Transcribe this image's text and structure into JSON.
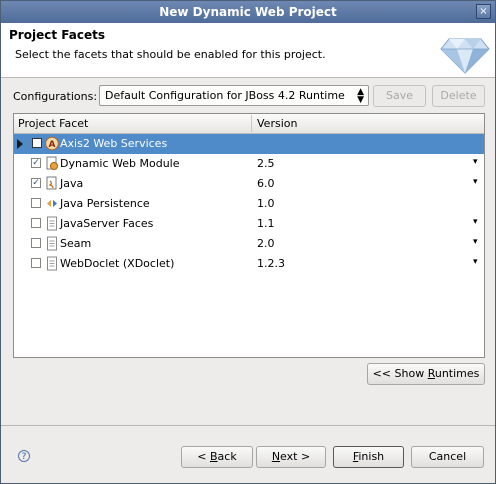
{
  "window": {
    "title": "New Dynamic Web Project",
    "close_glyph": "×"
  },
  "header": {
    "title": "Project Facets",
    "description": "Select the facets that should be enabled for this project.",
    "icon": "diamond-wizard-icon"
  },
  "config": {
    "label": "Configurations:",
    "selected": "Default Configuration for JBoss 4.2 Runtime",
    "save_label": "Save",
    "delete_label": "Delete"
  },
  "table": {
    "columns": [
      "Project Facet",
      "Version"
    ],
    "rows": [
      {
        "name": "Axis2 Web Services",
        "version": "",
        "checked": false,
        "selected": true,
        "icon": "axis2-icon",
        "dropdown": false,
        "expander": true
      },
      {
        "name": "Dynamic Web Module",
        "version": "2.5",
        "checked": true,
        "icon": "web-module-icon",
        "dropdown": true
      },
      {
        "name": "Java",
        "version": "6.0",
        "checked": true,
        "icon": "java-icon",
        "dropdown": true
      },
      {
        "name": "Java Persistence",
        "version": "1.0",
        "checked": false,
        "icon": "persistence-icon",
        "dropdown": false
      },
      {
        "name": "JavaServer Faces",
        "version": "1.1",
        "checked": false,
        "icon": "page-icon",
        "dropdown": true
      },
      {
        "name": "Seam",
        "version": "2.0",
        "checked": false,
        "icon": "page-icon",
        "dropdown": true
      },
      {
        "name": "WebDoclet (XDoclet)",
        "version": "1.2.3",
        "checked": false,
        "icon": "page-icon",
        "dropdown": true
      }
    ],
    "dropdown_glyph": "▾",
    "check_glyph": "✓"
  },
  "buttons": {
    "show_runtimes_pre": "<< Show ",
    "show_runtimes_mn": "R",
    "show_runtimes_post": "untimes",
    "back_pre": "< ",
    "back_mn": "B",
    "back_post": "ack",
    "next_pre": "",
    "next_mn": "N",
    "next_post": "ext >",
    "finish_pre": "",
    "finish_mn": "F",
    "finish_post": "inish",
    "cancel": "Cancel"
  },
  "help_glyph": "?",
  "colors": {
    "selection": "#4f8ac9",
    "titlebar": "#5d7aa6"
  }
}
